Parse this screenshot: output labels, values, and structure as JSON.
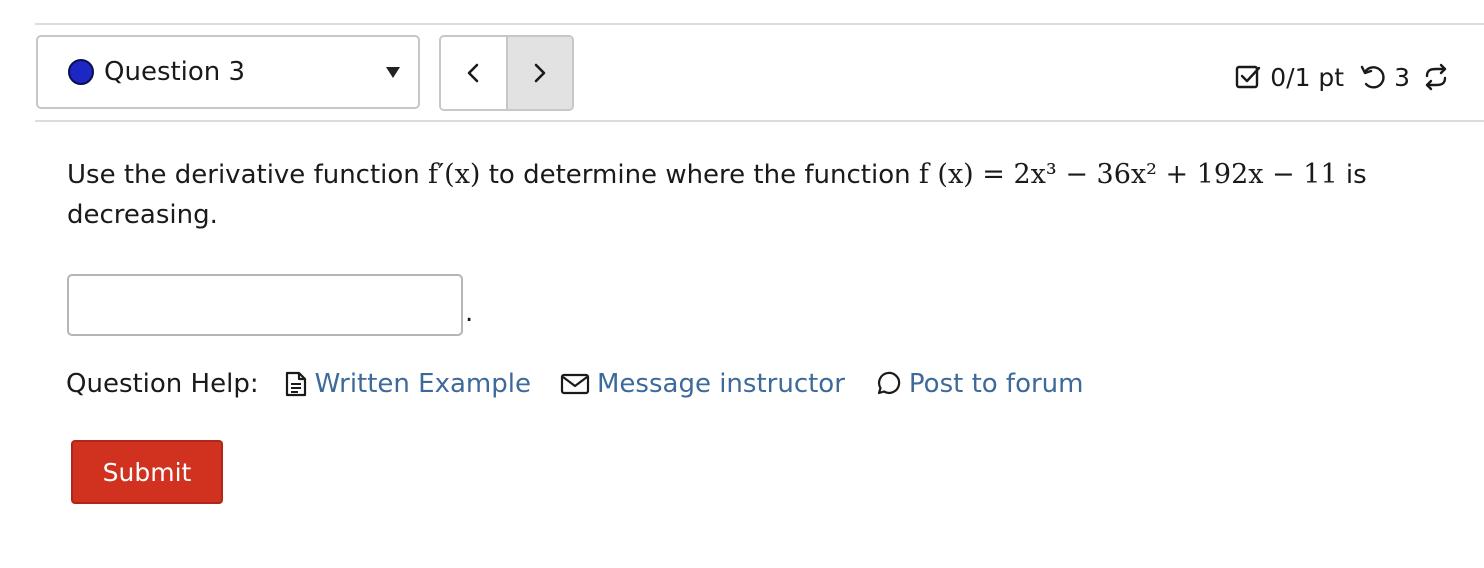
{
  "header": {
    "question_label": "Question 3",
    "score": "0/1 pt",
    "attempts": "3"
  },
  "question": {
    "text_before": "Use the derivative function",
    "text_middle": "to determine where the function",
    "math_fprime": "f′(x)",
    "math_f": "f (x) = 2x³ − 36x² + 192x − 11",
    "text_after": "is decreasing.",
    "answer_value": "",
    "answer_suffix": "."
  },
  "help": {
    "label": "Question Help:",
    "links": [
      {
        "label": "Written Example",
        "icon": "document-icon"
      },
      {
        "label": "Message instructor",
        "icon": "envelope-icon"
      },
      {
        "label": "Post to forum",
        "icon": "chat-bubble-icon"
      }
    ]
  },
  "submit_label": "Submit",
  "colors": {
    "status_dot": "#1d27c4",
    "link": "#3d6a9a",
    "submit": "#d1321f"
  }
}
